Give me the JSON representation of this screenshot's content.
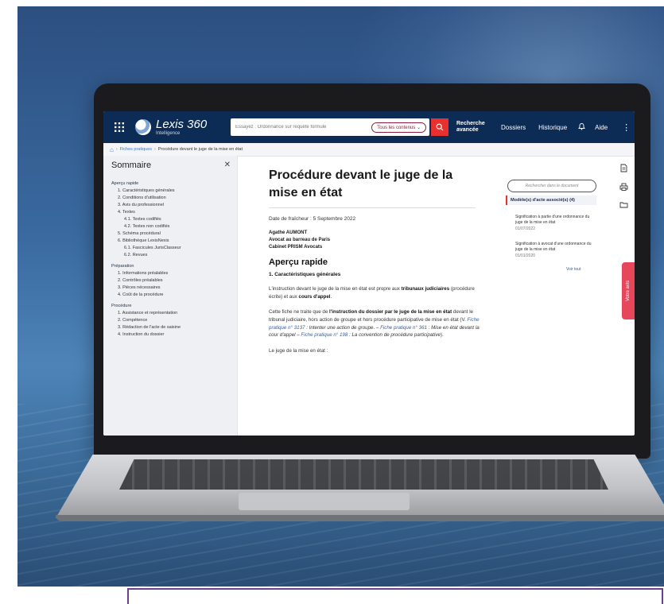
{
  "header": {
    "logo_name": "Lexis 360",
    "logo_sub": "Intelligence",
    "search_placeholder": "Essayez : Ordonnance sur requête formule",
    "scope": "Tous les contenus",
    "advanced_line1": "Recherche",
    "advanced_line2": "avancée",
    "nav": [
      "Dossiers",
      "Historique",
      "Aide"
    ]
  },
  "breadcrumb": {
    "items": [
      "Fiches pratiques",
      "Procédure devant le juge de la mise en état"
    ]
  },
  "sidebar": {
    "title": "Sommaire",
    "sections": [
      {
        "label": "Aperçu rapide",
        "items": [
          {
            "label": "1. Caractéristiques générales",
            "level": 1
          },
          {
            "label": "2. Conditions d'utilisation",
            "level": 1
          },
          {
            "label": "3. Avis du professionnel",
            "level": 1
          },
          {
            "label": "4. Textes",
            "level": 1
          },
          {
            "label": "4.1. Textes codifiés",
            "level": 2
          },
          {
            "label": "4.2. Textes non codifiés",
            "level": 2
          },
          {
            "label": "5. Schéma procédural",
            "level": 1
          },
          {
            "label": "6. Bibliothèque LexisNexis",
            "level": 1
          },
          {
            "label": "6.1. Fascicules JurisClasseur",
            "level": 2
          },
          {
            "label": "6.2. Revues",
            "level": 2
          }
        ]
      },
      {
        "label": "Préparation",
        "items": [
          {
            "label": "1. Informations préalables",
            "level": 1
          },
          {
            "label": "2. Contrôles préalables",
            "level": 1
          },
          {
            "label": "3. Pièces nécessaires",
            "level": 1
          },
          {
            "label": "4. Coût de la procédure",
            "level": 1
          }
        ]
      },
      {
        "label": "Procédure",
        "items": [
          {
            "label": "1. Assistance et représentation",
            "level": 1
          },
          {
            "label": "2. Compétence",
            "level": 1
          },
          {
            "label": "3. Rédaction de l'acte de saisine",
            "level": 1
          },
          {
            "label": "4. Instruction du dossier",
            "level": 1
          }
        ]
      }
    ]
  },
  "main": {
    "title": "Procédure devant le juge de la mise en état",
    "freshness": "Date de fraîcheur : 5 Septembre 2022",
    "author_name": "Agathe AUMONT",
    "author_role": "Avocat au barreau de Paris",
    "author_firm": "Cabinet PRISM Avocats",
    "section_title": "Aperçu rapide",
    "subsection_title": "1. Caractéristiques générales",
    "para1": {
      "t1": "L'instruction devant le juge de la mise en état est propre aux ",
      "b1": "tribunaux judiciaires",
      "t2": " (procédure écrite) et aux ",
      "b2": "cours d'appel",
      "t3": "."
    },
    "para2": {
      "t1": "Cette fiche ne traite que de ",
      "b1": "l'instruction du dossier par le juge de la mise en état",
      "t2": " devant le tribunal judiciaire, hors action de groupe et hors procédure participative de mise en état (V. ",
      "l1": "Fiche pratique n° 3137",
      "i1": " : Intenter une action de groupe",
      "t3": ". – ",
      "l2": "Fiche pratique n° 361",
      "i2": " : Mise en état devant la cour d'appel",
      "t4": " – ",
      "l3": "Fiche pratique n° 198",
      "i3": " : La convention de procédure participative",
      "t5": ")."
    },
    "para3": "Le juge de la mise en état :"
  },
  "right_panel": {
    "search_placeholder": "Rechercher dans le document",
    "models_heading": "Modèle(s) d'acte associé(s) (4)",
    "models": [
      {
        "label": "Signification à partie d'une ordonnance du juge de la mise en état",
        "date": "01/07/2022"
      },
      {
        "label": "Signification à avocat d'une ordonnance du juge de la mise en état",
        "date": "01/01/2020"
      }
    ],
    "see_all": "Voir tout"
  },
  "feedback_label": "Votre avis",
  "icons": [
    "apps-grid-icon",
    "search-icon",
    "bell-icon",
    "more-vertical-icon",
    "home-icon",
    "close-icon",
    "document-icon",
    "print-icon",
    "folder-icon",
    "feedback-icon"
  ],
  "colors": {
    "topbar": "#0c2b55",
    "accent_red": "#e8302f",
    "scope_border": "#8a1e3f",
    "link": "#355fa0"
  }
}
